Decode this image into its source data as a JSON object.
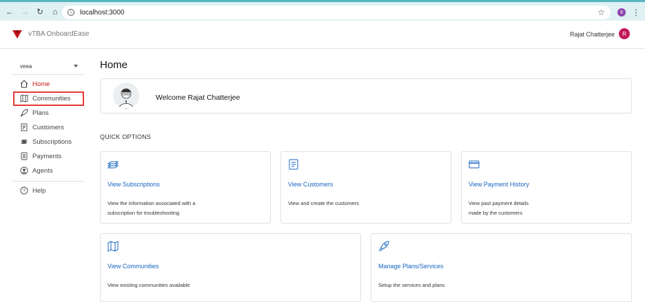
{
  "browser": {
    "url": "localhost:3000",
    "profile_initial": "9"
  },
  "header": {
    "app_name": "vTBA OnboardEase",
    "user_name": "Rajat Chatterjee",
    "avatar_initial": "R",
    "brand_color": "#c4161c"
  },
  "sidebar": {
    "tenant": "veea",
    "items": [
      {
        "label": "Home",
        "icon": "home-icon",
        "active": true
      },
      {
        "label": "Communities",
        "icon": "map-icon",
        "active": false
      },
      {
        "label": "Plans",
        "icon": "rocket-icon",
        "active": false
      },
      {
        "label": "Customers",
        "icon": "customers-icon",
        "active": false
      },
      {
        "label": "Subscriptions",
        "icon": "stack-icon",
        "active": false
      },
      {
        "label": "Payments",
        "icon": "receipt-icon",
        "active": false
      },
      {
        "label": "Agents",
        "icon": "agent-icon",
        "active": false
      }
    ],
    "help": {
      "label": "Help",
      "icon": "help-icon"
    }
  },
  "main": {
    "title": "Home",
    "welcome": "Welcome Rajat Chatterjee",
    "quick_options_label": "QUICK OPTIONS",
    "cards": [
      {
        "title": "View Subscriptions",
        "desc_line1": "View the information associated with a",
        "desc_line2": "subscription for troubleshooting",
        "icon": "stack-icon"
      },
      {
        "title": "View Customers",
        "desc_line1": "View and create the customers",
        "desc_line2": "",
        "icon": "document-icon"
      },
      {
        "title": "View Payment History",
        "desc_line1": "View past payment details",
        "desc_line2": "made by the customers",
        "icon": "credit-card-icon"
      },
      {
        "title": "View Communities",
        "desc_line1": "View existing communities available",
        "desc_line2": "",
        "icon": "map-icon"
      },
      {
        "title": "Manage Plans/Services",
        "desc_line1": "Setup the services and plans",
        "desc_line2": "",
        "icon": "rocket-icon"
      }
    ]
  },
  "colors": {
    "accent_link": "#1565c0",
    "highlight": "#e53935"
  }
}
